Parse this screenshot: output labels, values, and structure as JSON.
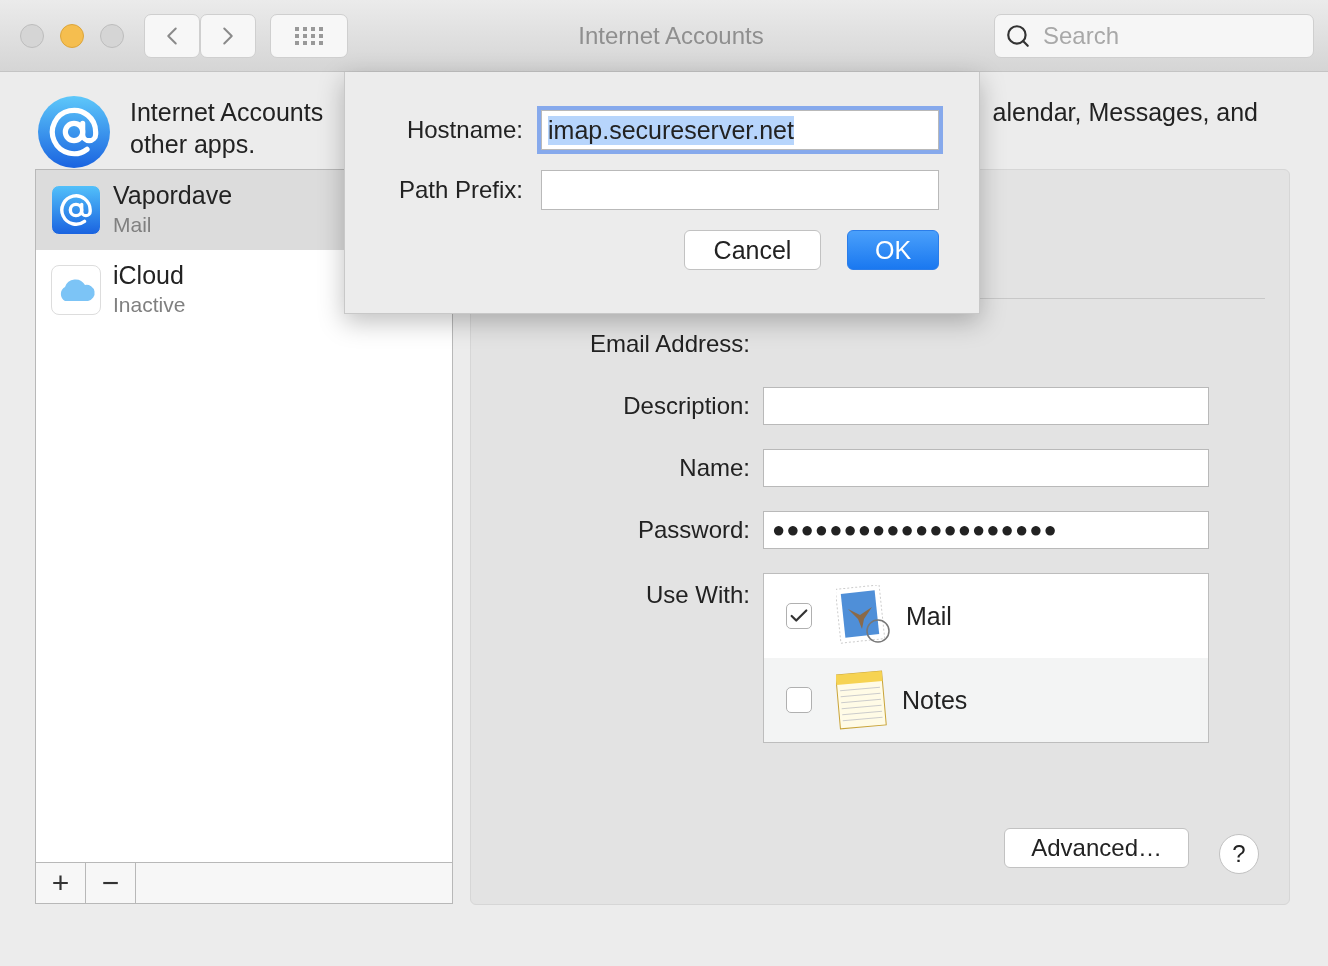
{
  "window": {
    "title": "Internet Accounts"
  },
  "toolbar": {
    "search": {
      "placeholder": "Search"
    }
  },
  "header": {
    "text_left": [
      "Internet Accounts",
      "other apps."
    ],
    "text_right": "alendar, Messages, and"
  },
  "accounts": [
    {
      "name": "Vapordave",
      "detail": "Mail",
      "kind": "mail",
      "selected": true
    },
    {
      "name": "iCloud",
      "detail": "Inactive",
      "kind": "icloud",
      "selected": false
    }
  ],
  "list_buttons": [
    "+",
    "−"
  ],
  "form": {
    "fields": [
      {
        "label": "Email Address:",
        "kind": "static"
      },
      {
        "label": "Description:",
        "kind": "field"
      },
      {
        "label": "Name:",
        "kind": "field"
      },
      {
        "label": "Password:",
        "kind": "field",
        "value": "●●●●●●●●●●●●●●●●●●●●"
      }
    ],
    "use_with": {
      "label": "Use With:",
      "apps": [
        {
          "name": "Mail",
          "kind": "mail",
          "checked": true
        },
        {
          "name": "Notes",
          "kind": "notes",
          "checked": false
        }
      ]
    }
  },
  "advanced_button": "Advanced…",
  "help_button": "?",
  "sheet": {
    "fields": [
      {
        "label": "Hostname:",
        "value": "imap.secureserver.net",
        "focused": true
      },
      {
        "label": "Path Prefix:",
        "focused": false
      }
    ],
    "buttons": [
      {
        "label": "Cancel",
        "default": false
      },
      {
        "label": "OK",
        "default": true
      }
    ]
  }
}
